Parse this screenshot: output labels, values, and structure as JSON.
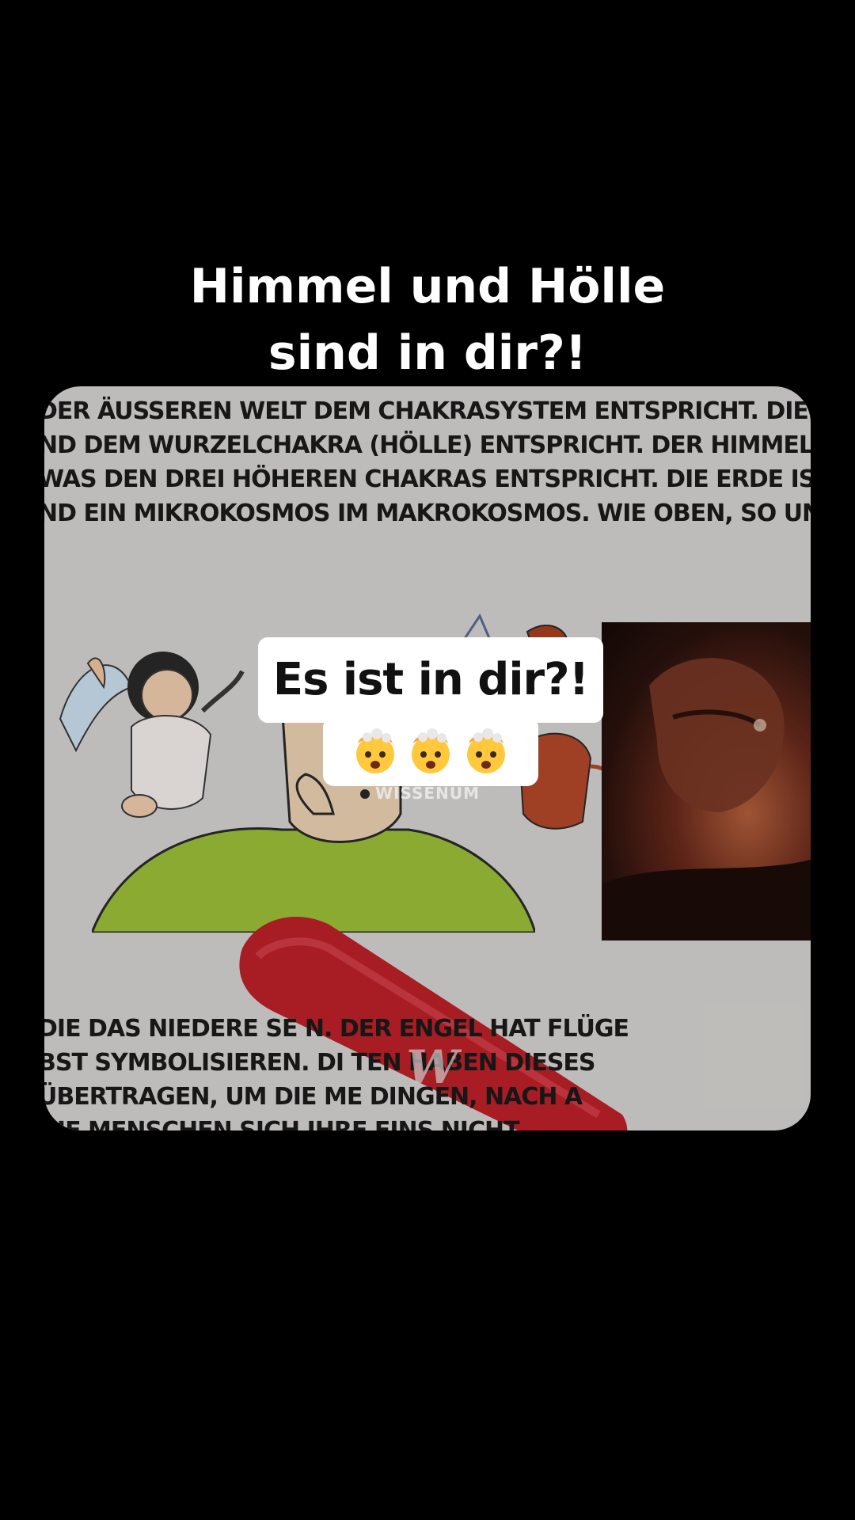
{
  "headline": {
    "line1": "Himmel und Hölle",
    "line2": "sind in dir?!"
  },
  "book_page": {
    "top_lines": [
      "DER ÄUSSEREN WELT DEM CHAKRASYSTEM ENTSPRICHT. DIE LAVA",
      "ND DEM WURZELCHAKRA (HÖLLE) ENTSPRICHT. DER HIMMEL IST BLA",
      "WAS DEN DREI HÖHEREN CHAKRAS ENTSPRICHT. DIE ERDE IST GRÜ",
      "ND EIN MIKROKOSMOS IM MAKROKOSMOS. WIE OBEN, SO UNTE"
    ],
    "bottom_lines": [
      "DIE DAS NIEDERE SE                    N. DER ENGEL HAT FLÜGE",
      "BST SYMBOLISIEREN. DI                    TEN HABEN DIESES",
      "ÜBERTRAGEN, UM DIE ME                  DINGEN, NACH A",
      "DIE MENSCHEN SICH IHRE                 EINS NICHT"
    ],
    "logo_text": "W"
  },
  "caption": {
    "main": "Es ist in dir?!",
    "emoji_icons": [
      "exploding-head-icon",
      "exploding-head-icon",
      "exploding-head-icon"
    ]
  },
  "watermark": "WISSENUM",
  "colors": {
    "background": "#000000",
    "page": "#d9d7d4",
    "shirt": "#9fc23a",
    "marker": "#c0202a",
    "caption_bg": "#ffffff"
  }
}
